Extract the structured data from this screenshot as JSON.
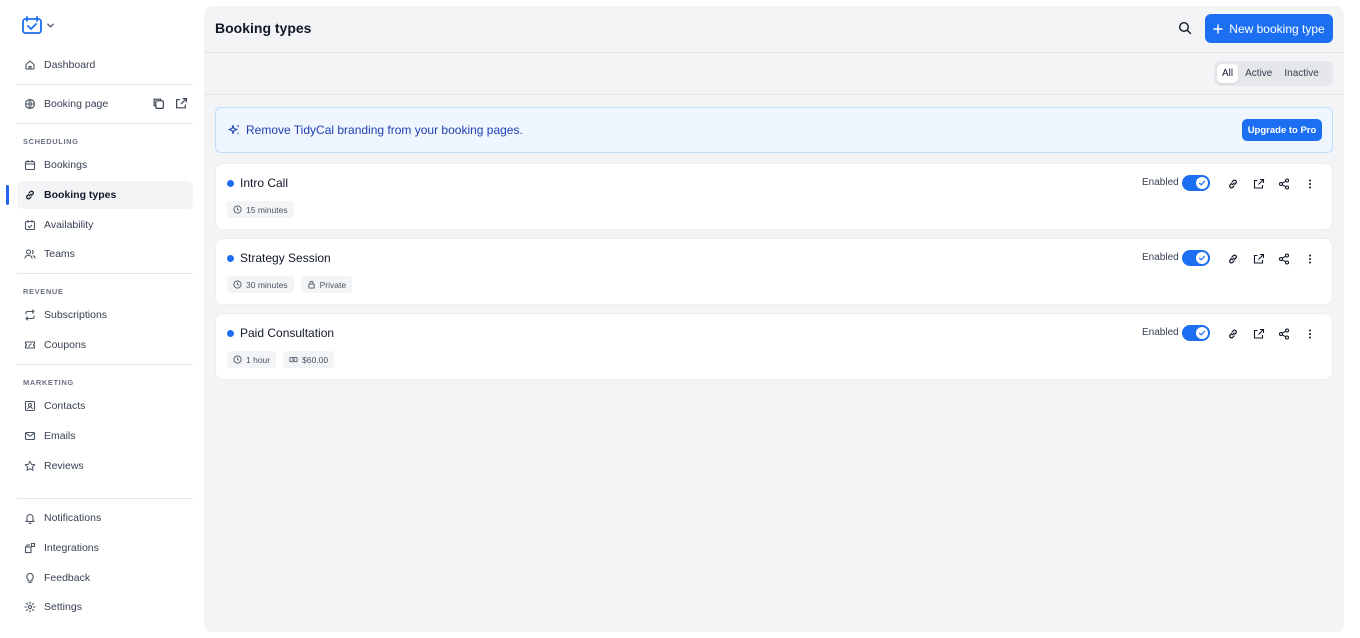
{
  "sidebar": {
    "dashboard": "Dashboard",
    "booking_page": "Booking page",
    "sections": {
      "scheduling": "SCHEDULING",
      "revenue": "REVENUE",
      "marketing": "MARKETING"
    },
    "bookings": "Bookings",
    "booking_types": "Booking types",
    "availability": "Availability",
    "teams": "Teams",
    "subscriptions": "Subscriptions",
    "coupons": "Coupons",
    "contacts": "Contacts",
    "emails": "Emails",
    "reviews": "Reviews",
    "notifications": "Notifications",
    "integrations": "Integrations",
    "feedback": "Feedback",
    "settings": "Settings"
  },
  "header": {
    "title": "Booking types",
    "new_button": "New booking type"
  },
  "filters": {
    "all": "All",
    "active": "Active",
    "inactive": "Inactive",
    "selected": "All"
  },
  "banner": {
    "text": "Remove TidyCal branding from your booking pages.",
    "button": "Upgrade to Pro"
  },
  "accent_color": "#1d6ff2",
  "booking_types": [
    {
      "name": "Intro Call",
      "duration": "15 minutes",
      "extra": "",
      "status": "Enabled",
      "enabled": true
    },
    {
      "name": "Strategy Session",
      "duration": "30 minutes",
      "extra": "Private",
      "status": "Enabled",
      "enabled": true
    },
    {
      "name": "Paid Consultation",
      "duration": "1 hour",
      "extra": "$60.00",
      "status": "Enabled",
      "enabled": true
    }
  ]
}
